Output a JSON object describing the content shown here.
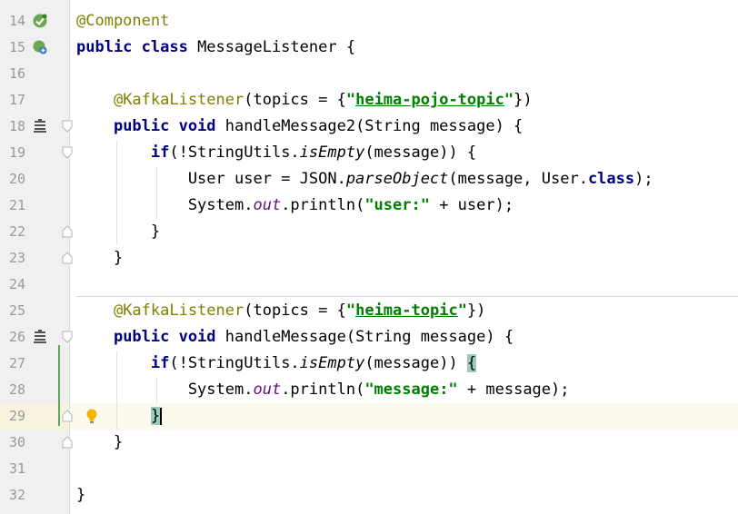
{
  "editor": {
    "lines": [
      {
        "no": "14",
        "tokens": [
          {
            "t": "@Component",
            "c": "t-ann"
          }
        ]
      },
      {
        "no": "15",
        "tokens": [
          {
            "t": "public class ",
            "c": "t-kw"
          },
          {
            "t": "MessageListener {",
            "c": ""
          }
        ]
      },
      {
        "no": "16",
        "tokens": []
      },
      {
        "no": "17",
        "tokens": [
          {
            "t": "    ",
            "c": ""
          },
          {
            "t": "@KafkaListener",
            "c": "t-ann"
          },
          {
            "t": "(topics = {",
            "c": ""
          },
          {
            "t": "\"",
            "c": "t-str"
          },
          {
            "t": "heima-pojo-topic",
            "c": "t-strlink"
          },
          {
            "t": "\"",
            "c": "t-str"
          },
          {
            "t": "})",
            "c": ""
          }
        ]
      },
      {
        "no": "18",
        "tokens": [
          {
            "t": "    ",
            "c": ""
          },
          {
            "t": "public void ",
            "c": "t-kw"
          },
          {
            "t": "handleMessage2(String message) {",
            "c": ""
          }
        ]
      },
      {
        "no": "19",
        "tokens": [
          {
            "t": "        ",
            "c": ""
          },
          {
            "t": "if",
            "c": "t-kw"
          },
          {
            "t": "(!StringUtils.",
            "c": ""
          },
          {
            "t": "isEmpty",
            "c": "t-static"
          },
          {
            "t": "(message)) {",
            "c": ""
          }
        ]
      },
      {
        "no": "20",
        "tokens": [
          {
            "t": "            User user = JSON.",
            "c": ""
          },
          {
            "t": "parseObject",
            "c": "t-static"
          },
          {
            "t": "(message, User.",
            "c": ""
          },
          {
            "t": "class",
            "c": "t-kw"
          },
          {
            "t": ");",
            "c": ""
          }
        ]
      },
      {
        "no": "21",
        "tokens": [
          {
            "t": "            System.",
            "c": ""
          },
          {
            "t": "out",
            "c": "t-field"
          },
          {
            "t": ".println(",
            "c": ""
          },
          {
            "t": "\"user:\"",
            "c": "t-str"
          },
          {
            "t": " + user);",
            "c": ""
          }
        ]
      },
      {
        "no": "22",
        "tokens": [
          {
            "t": "        }",
            "c": ""
          }
        ]
      },
      {
        "no": "23",
        "tokens": [
          {
            "t": "    }",
            "c": ""
          }
        ]
      },
      {
        "no": "24",
        "tokens": []
      },
      {
        "no": "25",
        "tokens": [
          {
            "t": "    ",
            "c": ""
          },
          {
            "t": "@KafkaListener",
            "c": "t-ann"
          },
          {
            "t": "(topics = {",
            "c": ""
          },
          {
            "t": "\"",
            "c": "t-str"
          },
          {
            "t": "heima-topic",
            "c": "t-strlink"
          },
          {
            "t": "\"",
            "c": "t-str"
          },
          {
            "t": "})",
            "c": ""
          }
        ]
      },
      {
        "no": "26",
        "tokens": [
          {
            "t": "    ",
            "c": ""
          },
          {
            "t": "public void ",
            "c": "t-kw"
          },
          {
            "t": "handleMessage(String message) {",
            "c": ""
          }
        ]
      },
      {
        "no": "27",
        "tokens": [
          {
            "t": "        ",
            "c": ""
          },
          {
            "t": "if",
            "c": "t-kw"
          },
          {
            "t": "(!StringUtils.",
            "c": ""
          },
          {
            "t": "isEmpty",
            "c": "t-static"
          },
          {
            "t": "(message)) ",
            "c": ""
          },
          {
            "t": "{",
            "c": "t-match"
          }
        ]
      },
      {
        "no": "28",
        "tokens": [
          {
            "t": "            System.",
            "c": ""
          },
          {
            "t": "out",
            "c": "t-field"
          },
          {
            "t": ".println(",
            "c": ""
          },
          {
            "t": "\"message:\"",
            "c": "t-str"
          },
          {
            "t": " + message);",
            "c": ""
          }
        ]
      },
      {
        "no": "29",
        "tokens": [
          {
            "t": "        ",
            "c": ""
          },
          {
            "t": "}",
            "c": "t-caret-brace"
          }
        ],
        "caret": true
      },
      {
        "no": "30",
        "tokens": [
          {
            "t": "    }",
            "c": ""
          }
        ]
      },
      {
        "no": "31",
        "tokens": []
      },
      {
        "no": "32",
        "tokens": [
          {
            "t": "}",
            "c": ""
          }
        ]
      }
    ],
    "colors": {
      "keyword": "#000080",
      "annotation": "#808000",
      "string": "#008000",
      "field": "#660e7a",
      "gutter_bg": "#f0f0f0",
      "caret_row": "#fcfaed",
      "brace_match": "#99ccbb",
      "vcs_modified": "#5aa85a"
    },
    "gutter_icons": [
      {
        "line": "14",
        "icon": "spring-bean-icon"
      },
      {
        "line": "15",
        "icon": "spring-bean-navigate-icon"
      },
      {
        "line": "18",
        "icon": "method-icon"
      },
      {
        "line": "26",
        "icon": "method-icon"
      },
      {
        "line": "29",
        "icon": "lightbulb-intention-icon"
      }
    ]
  }
}
